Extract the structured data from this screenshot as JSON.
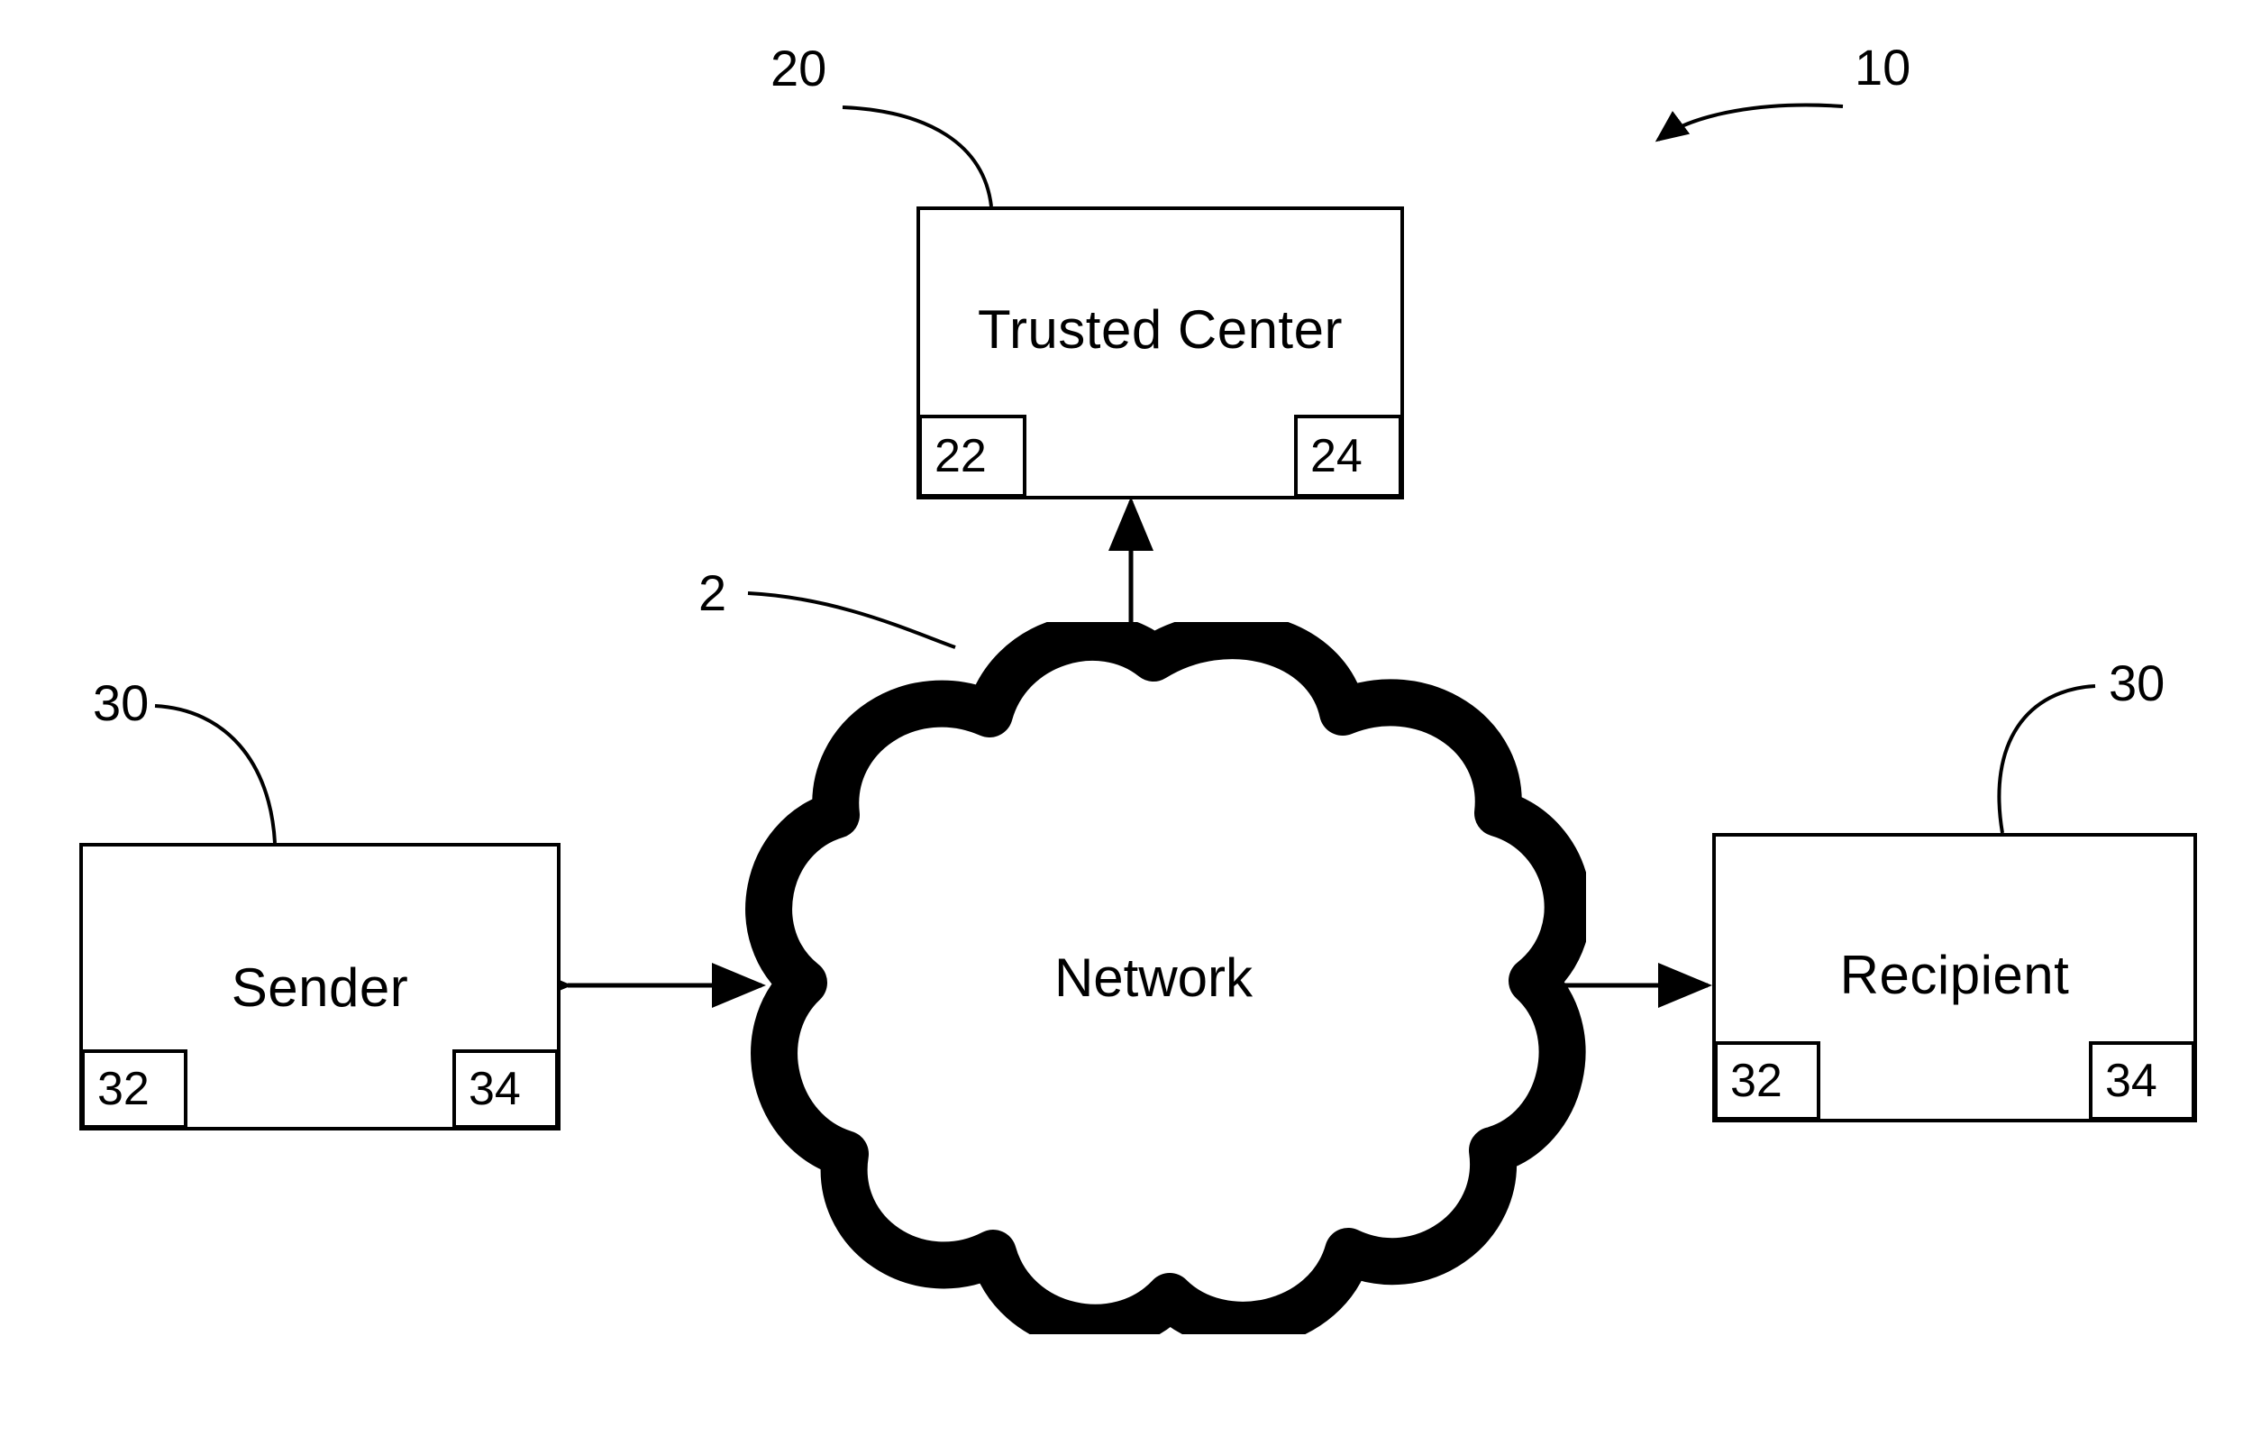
{
  "figure": {
    "type": "patent-block-diagram",
    "background_color": "#ffffff",
    "line_color": "#000000",
    "overall_reference": "10"
  },
  "nodes": {
    "trusted_center": {
      "label": "Trusted Center",
      "reference": "20",
      "sub_left": "22",
      "sub_right": "24"
    },
    "network": {
      "label": "Network",
      "reference": "2"
    },
    "sender": {
      "label": "Sender",
      "reference": "30",
      "sub_left": "32",
      "sub_right": "34"
    },
    "recipient": {
      "label": "Recipient",
      "reference": "30",
      "sub_left": "32",
      "sub_right": "34"
    }
  },
  "connections": [
    {
      "name": "trusted-center-to-network",
      "from": "trusted_center",
      "to": "network",
      "style": "double-arrow-vertical"
    },
    {
      "name": "sender-to-network",
      "from": "sender",
      "to": "network",
      "style": "double-arrow-horizontal"
    },
    {
      "name": "network-to-recipient",
      "from": "network",
      "to": "recipient",
      "style": "double-arrow-horizontal"
    }
  ],
  "leaders": [
    {
      "name": "leader-10",
      "reference": "10"
    },
    {
      "name": "leader-20",
      "reference": "20"
    },
    {
      "name": "leader-2",
      "reference": "2"
    },
    {
      "name": "leader-30-left",
      "reference": "30"
    },
    {
      "name": "leader-30-right",
      "reference": "30"
    }
  ]
}
